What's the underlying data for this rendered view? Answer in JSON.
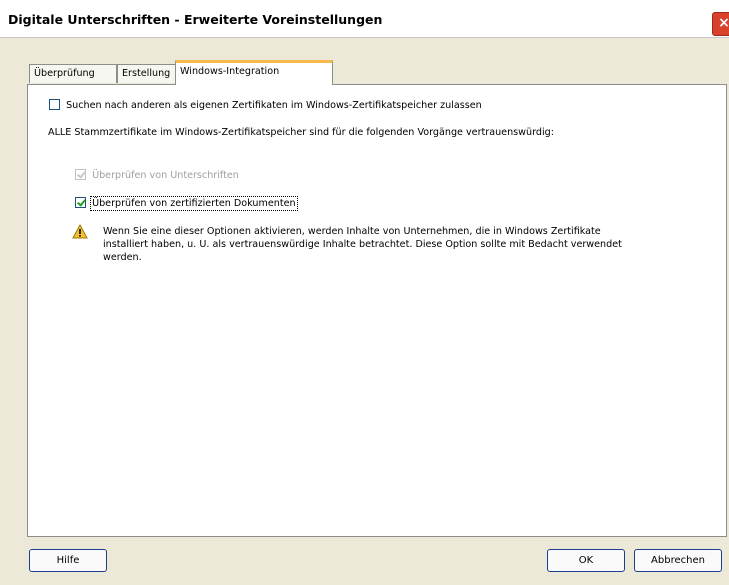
{
  "window": {
    "title": "Digitale Unterschriften - Erweiterte Voreinstellungen",
    "close_label": "×"
  },
  "tabs": [
    {
      "label": "Überprüfung"
    },
    {
      "label": "Erstellung"
    },
    {
      "label": "Windows-Integration",
      "active": true
    }
  ],
  "content": {
    "option_search": {
      "label": "Suchen nach anderen als eigenen Zertifikaten im Windows-Zertifikatspeicher zulassen",
      "checked": false
    },
    "trust_text": "ALLE Stammzertifikate im Windows-Zertifikatspeicher sind für die folgenden Vorgänge vertrauenswürdig:",
    "option_signatures": {
      "label": "Überprüfen von Unterschriften",
      "checked": true,
      "disabled": true
    },
    "option_certified": {
      "label": "Überprüfen von zertifizierten Dokumenten",
      "checked": true
    },
    "warning_text": "Wenn Sie eine dieser Optionen aktivieren, werden Inhalte von Unternehmen, die in Windows Zertifikate installiert haben, u. U. als vertrauenswürdige Inhalte betrachtet. Diese Option sollte mit Bedacht verwendet werden.",
    "warning_icon": "warning-triangle-icon"
  },
  "buttons": {
    "help": "Hilfe",
    "ok": "OK",
    "cancel": "Abbrechen"
  },
  "colors": {
    "tab_accent": "#f5b94c",
    "checkmark": "#21a121",
    "warning": "#f4c430"
  }
}
